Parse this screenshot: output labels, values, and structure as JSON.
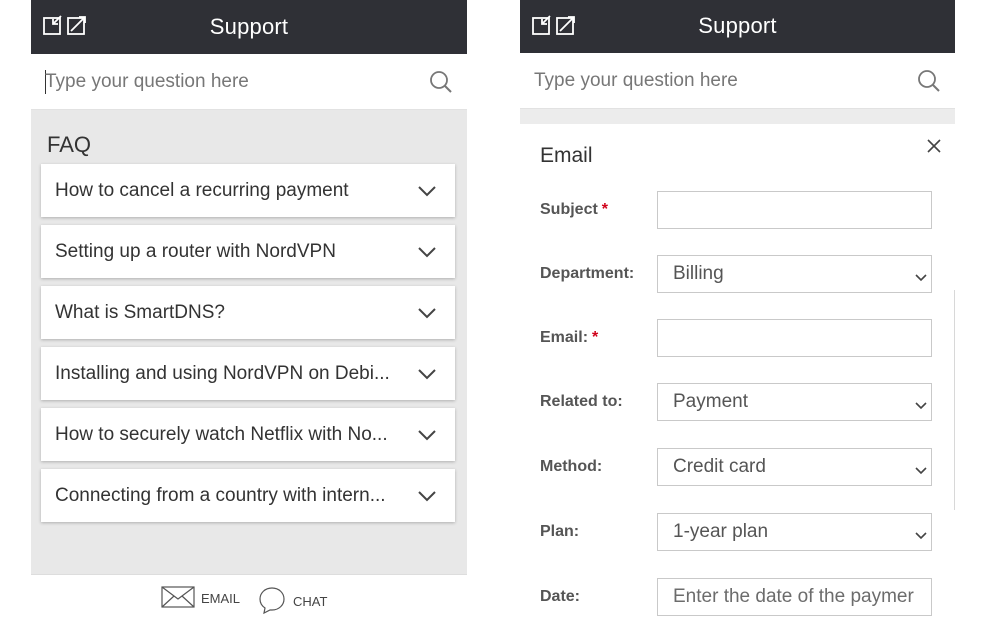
{
  "left": {
    "header": {
      "title": "Support",
      "icons": [
        "minimize-icon",
        "expand-icon"
      ]
    },
    "search": {
      "placeholder": "Type your question here",
      "icon": "search-icon"
    },
    "faq": {
      "title": "FAQ",
      "items": [
        "How to cancel a recurring payment",
        "Setting up a router with NordVPN",
        "What is SmartDNS?",
        "Installing and using NordVPN on Debi...",
        "How to securely watch Netflix with No...",
        "Connecting from a country with intern..."
      ]
    },
    "bottom": {
      "email_label": "EMAIL",
      "chat_label": "CHAT"
    }
  },
  "right": {
    "header": {
      "title": "Support"
    },
    "search": {
      "placeholder": "Type your question here"
    },
    "email_form": {
      "title": "Email",
      "subject_label": "Subject",
      "department_label": "Department:",
      "department_value": "Billing",
      "email_label": "Email:",
      "related_label": "Related to:",
      "related_value": "Payment",
      "method_label": "Method:",
      "method_value": "Credit card",
      "plan_label": "Plan:",
      "plan_value": "1-year plan",
      "date_label": "Date:",
      "date_placeholder": "Enter the date of the paymer",
      "required_mark": "*"
    }
  },
  "colors": {
    "header_bg": "#2f3036",
    "faq_bg": "#e8e8e8",
    "required": "#d0021b"
  }
}
